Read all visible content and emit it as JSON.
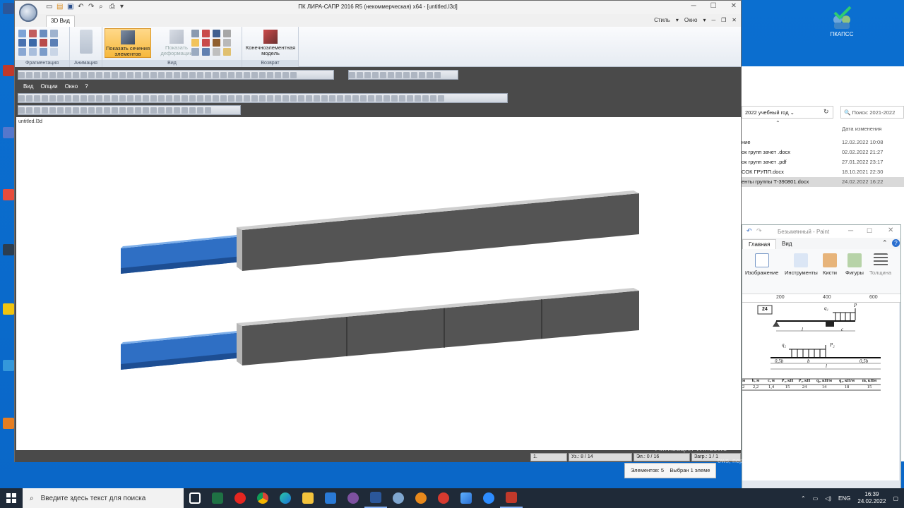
{
  "window": {
    "title": "ПК ЛИРА-САПР  2016 R5 (некоммерческая) x64 - [untitled.l3d]",
    "tab": "3D Вид",
    "style_menu": "Стиль",
    "window_menu": "Окно"
  },
  "ribbon": {
    "groups": [
      "Фрагментация",
      "Анимация",
      "Вид",
      "Возврат"
    ],
    "show_sections": "Показать сечения элементов",
    "show_deformation": "Показать деформации",
    "fe_model": "Конечноэлементная модель"
  },
  "menubar": [
    "Вид",
    "Опции",
    "Окно",
    "?"
  ],
  "viewport": {
    "file_label": "untitled.l3d"
  },
  "statusbar": {
    "field1": "1.",
    "nodes": "Уз.: 8 / 14",
    "elements": "Эл.: 0 / 16",
    "loads": "Загр.: 1 / 1"
  },
  "explorer": {
    "address": "2022 учебный год",
    "search": "Поиск: 2021-2022",
    "column_date": "Дата изменения",
    "rows": [
      {
        "name": "ние",
        "date": "12.02.2022 10:08"
      },
      {
        "name": "ок  групп  зачет .docx",
        "date": "02.02.2022 21:27"
      },
      {
        "name": "ок  групп  зачет .pdf",
        "date": "27.01.2022 23:17"
      },
      {
        "name": "СОК ГРУПП.docx",
        "date": "18.10.2021 22:30"
      },
      {
        "name": "енты  группы Т-390801.docx",
        "date": "24.02.2022 16:22"
      }
    ],
    "status_items": "Элементов: 5",
    "status_selected": "Выбран 1 элеме"
  },
  "paint": {
    "title": "Безымянный - Paint",
    "tabs": [
      "Главная",
      "Вид"
    ],
    "buttons": [
      "Изображение",
      "Инструменты",
      "Кисти",
      "Фигуры",
      "Толщина"
    ],
    "ruler": [
      "200",
      "400",
      "600"
    ],
    "sketch": {
      "number": "24",
      "q1": "q₁",
      "P": "P",
      "l": "l",
      "c": "c",
      "q2": "q₂",
      "P2": "P₂",
      "b": "b",
      "half_b": "0,5b",
      "table_header": [
        "м",
        "b, м",
        "c, м",
        "P₁, кН",
        "P₂, кН",
        "q₁, кН/м",
        "q₂, кН/м",
        "m, кНм"
      ],
      "table_row": [
        "2",
        "2,2",
        "1,4",
        "15",
        "24",
        "14",
        "18",
        "15"
      ]
    }
  },
  "desktop": {
    "pkapss_label": "ПКАПСС",
    "activation_line1": "Активация Windows",
    "activation_line2": "ows, перейдите в раздел \"Параметры\"."
  },
  "taskbar": {
    "search_placeholder": "Введите здесь текст для поиска",
    "lang": "ENG",
    "time": "16:39",
    "date": "24.02.2022"
  },
  "colors": {
    "beam_gray": "#545454",
    "beam_blue": "#2f6fc4",
    "ribbon_active": "#f6b83c",
    "desktop_blue": "#0a6fd0"
  }
}
